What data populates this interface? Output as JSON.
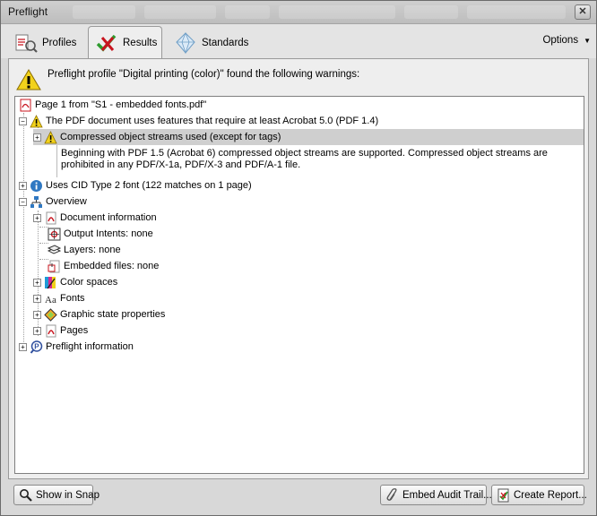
{
  "window": {
    "title": "Preflight",
    "close_label": "✕"
  },
  "tabs": [
    {
      "label": "Profiles",
      "icon": "profiles-icon"
    },
    {
      "label": "Results",
      "icon": "results-checkmark-icon",
      "active": true
    },
    {
      "label": "Standards",
      "icon": "standards-diamond-icon"
    }
  ],
  "options_label": "Options",
  "header": {
    "message": "Preflight profile \"Digital printing (color)\" found the following warnings:"
  },
  "tree": {
    "page": "Page 1 from \"S1 - embedded fonts.pdf\"",
    "acrobat_warning": "The PDF document uses features that require at least Acrobat 5.0 (PDF 1.4)",
    "compressed": "Compressed object streams used (except for tags)",
    "detail": "Beginning with PDF 1.5 (Acrobat 6) compressed object streams are supported. Compressed object streams are prohibited in any PDF/X-1a, PDF/X-3 and PDF/A-1 file.",
    "cid_font": "Uses CID Type 2 font (122 matches on 1 page)",
    "overview": "Overview",
    "overview_items": [
      "Document information",
      "Output Intents: none",
      "Layers: none",
      "Embedded files: none",
      "Color spaces",
      "Fonts",
      "Graphic state properties",
      "Pages"
    ],
    "preflight_info": "Preflight information"
  },
  "buttons": {
    "show_in_snap": "Show in Snap",
    "embed_audit": "Embed Audit Trail...",
    "create_report": "Create Report..."
  },
  "colors": {
    "warning": "#f2d21b",
    "pdf_red": "#c8141e",
    "selection": "#cfcfcf"
  }
}
